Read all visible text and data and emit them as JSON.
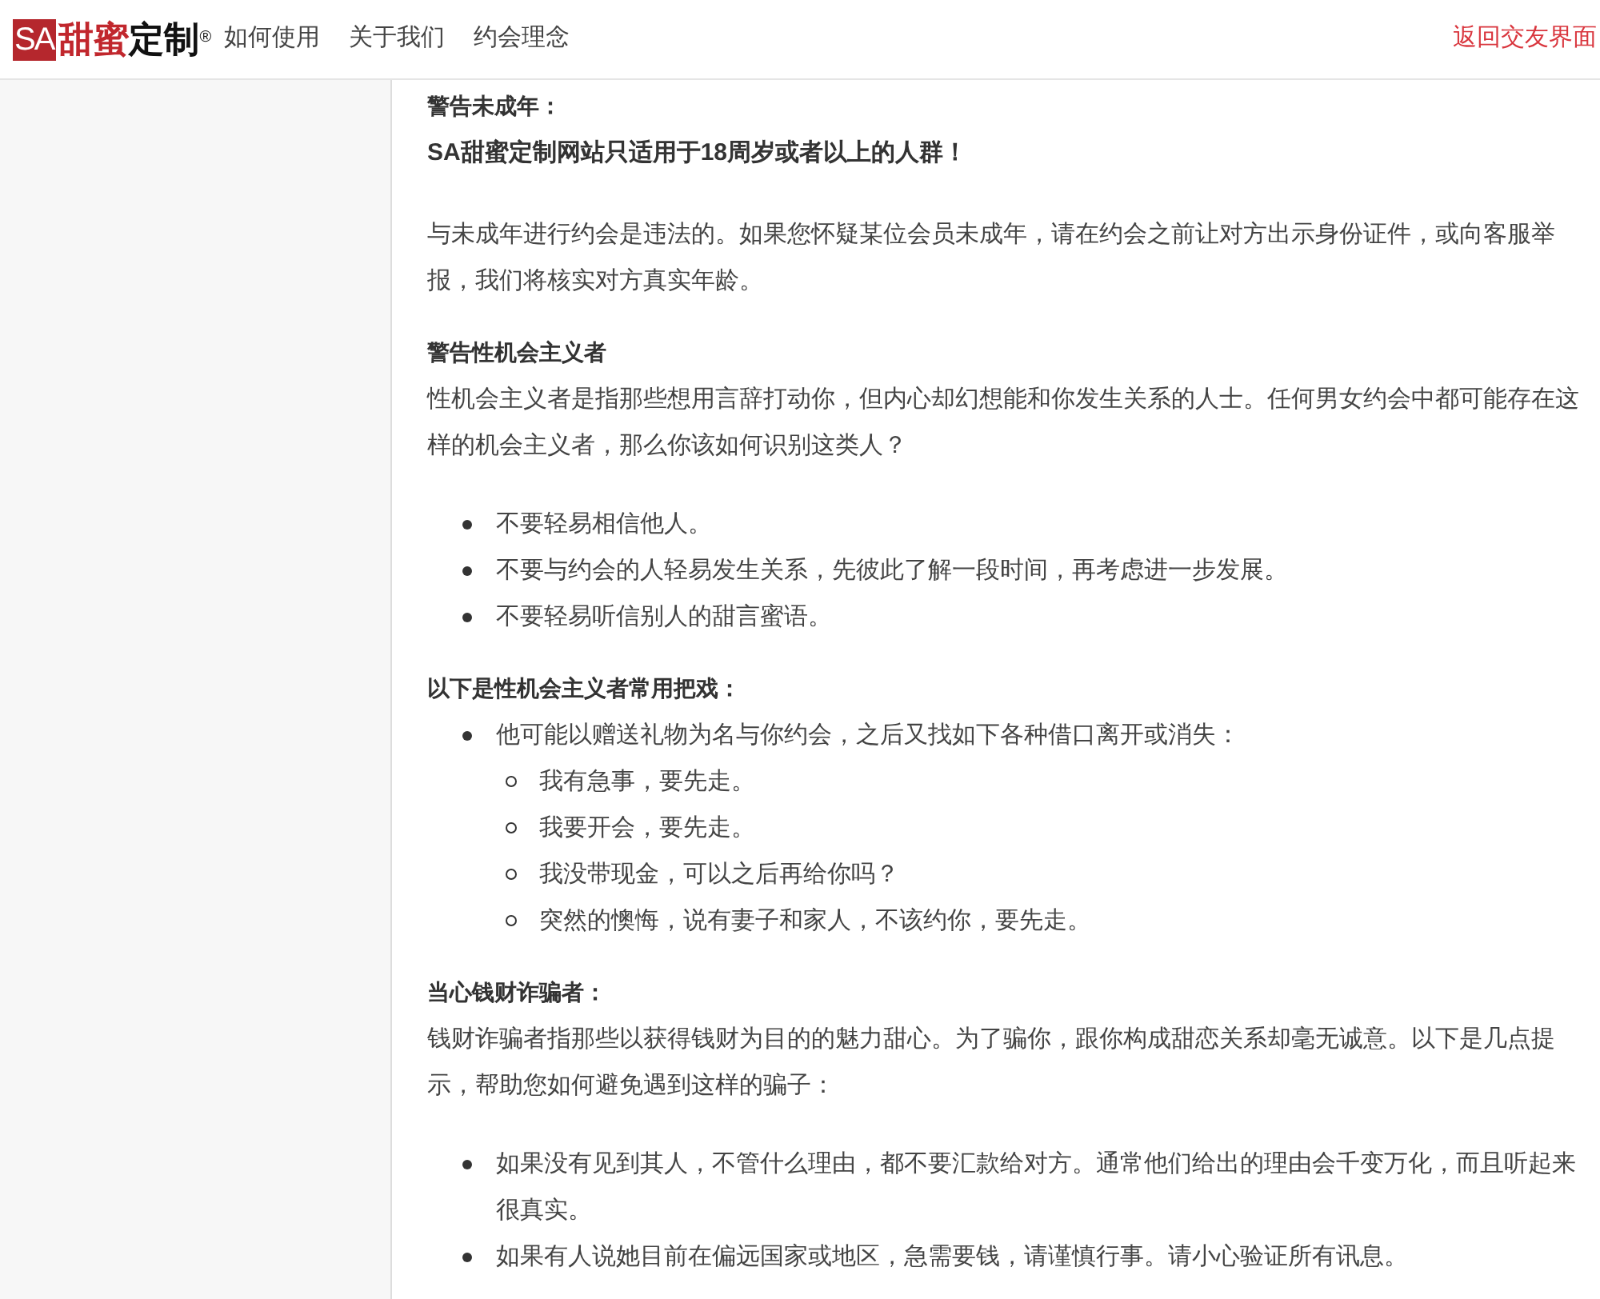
{
  "header": {
    "logo": {
      "badge": "SA",
      "brand_red": "甜蜜",
      "brand_dark": "定制",
      "mark": "®"
    },
    "nav": [
      "如何使用",
      "关于我们",
      "约会理念"
    ],
    "back_link": "返回交友界面"
  },
  "content": [
    {
      "kind": "heading",
      "text": "警告未成年："
    },
    {
      "kind": "strong",
      "text": "SA甜蜜定制网站只适用于18周岁或者以上的人群！"
    },
    {
      "kind": "paragraph",
      "text": "与未成年进行约会是违法的。如果您怀疑某位会员未成年，请在约会之前让对方出示身份证件，或向客服举报，我们将核实对方真实年龄。"
    },
    {
      "kind": "heading",
      "text": "警告性机会主义者"
    },
    {
      "kind": "paragraph",
      "text": "性机会主义者是指那些想用言辞打动你，但内心却幻想能和你发生关系的人士。任何男女约会中都可能存在这样的机会主义者，那么你该如何识别这类人？"
    },
    {
      "kind": "list",
      "items": [
        {
          "text": "不要轻易相信他人。"
        },
        {
          "text": "不要与约会的人轻易发生关系，先彼此了解一段时间，再考虑进一步发展。"
        },
        {
          "text": "不要轻易听信别人的甜言蜜语。"
        }
      ]
    },
    {
      "kind": "heading",
      "text": "以下是性机会主义者常用把戏："
    },
    {
      "kind": "list",
      "items": [
        {
          "text": "他可能以赠送礼物为名与你约会，之后又找如下各种借口离开或消失：",
          "children": [
            {
              "text": "我有急事，要先走。"
            },
            {
              "text": "我要开会，要先走。"
            },
            {
              "text": "我没带现金，可以之后再给你吗？"
            },
            {
              "text": "突然的懊悔，说有妻子和家人，不该约你，要先走。"
            }
          ]
        }
      ]
    },
    {
      "kind": "heading",
      "text": "当心钱财诈骗者："
    },
    {
      "kind": "paragraph",
      "text": "钱财诈骗者指那些以获得钱财为目的的魅力甜心。为了骗你，跟你构成甜恋关系却毫无诚意。以下是几点提示，帮助您如何避免遇到这样的骗子："
    },
    {
      "kind": "list",
      "items": [
        {
          "text": "如果没有见到其人，不管什么理由，都不要汇款给对方。通常他们给出的理由会千变万化，而且听起来很真实。"
        },
        {
          "text": "如果有人说她目前在偏远国家或地区，急需要钱，请谨慎行事。请小心验证所有讯息。"
        }
      ]
    }
  ]
}
